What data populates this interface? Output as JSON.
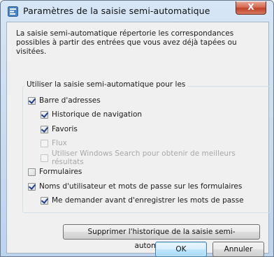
{
  "window": {
    "title": "Paramètres de la saisie semi-automatique",
    "close_label": "X"
  },
  "intro": "La saisie semi-automatique répertorie les correspondances possibles à partir des entrées que vous avez déjà tapées ou visitées.",
  "group": {
    "label": "Utiliser la saisie semi-automatique pour les"
  },
  "options": {
    "address_bar": {
      "label": "Barre d'adresses",
      "checked": true
    },
    "history": {
      "label": "Historique de navigation",
      "checked": true
    },
    "favorites": {
      "label": "Favoris",
      "checked": true
    },
    "feeds": {
      "label": "Flux",
      "checked": false,
      "disabled": true
    },
    "windows_search": {
      "label": "Utiliser Windows Search pour obtenir de meilleurs résultats",
      "checked": false,
      "disabled": true
    },
    "forms": {
      "label": "Formulaires",
      "checked": false
    },
    "passwords": {
      "label": "Noms d'utilisateur et mots de passe sur les formulaires",
      "checked": true
    },
    "ask_save": {
      "label": "Me demander avant d'enregistrer les mots de passe",
      "checked": true
    }
  },
  "buttons": {
    "delete_history": "Supprimer l'historique de la saisie semi-automatique...",
    "ok": "OK",
    "cancel": "Annuler"
  }
}
